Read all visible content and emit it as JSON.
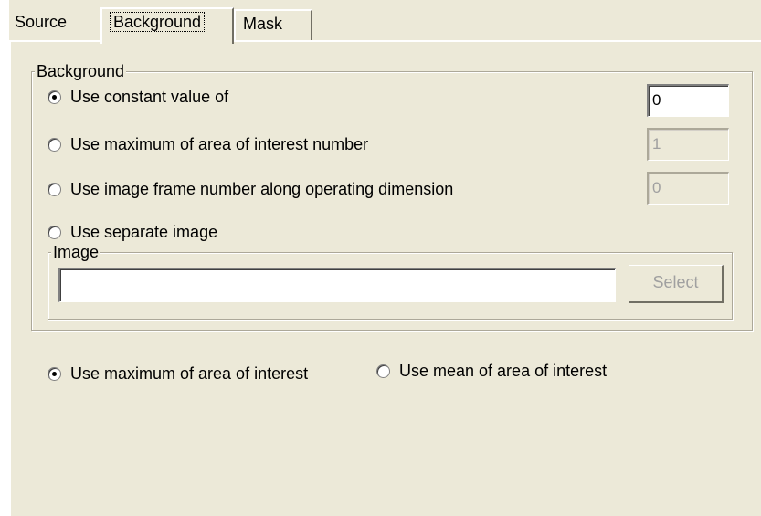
{
  "tabs": [
    {
      "label": "Source"
    },
    {
      "label": "Background"
    },
    {
      "label": "Mask"
    }
  ],
  "background_group": {
    "title": "Background",
    "options": [
      {
        "label": "Use constant value of",
        "checked": true,
        "value": "0",
        "value_enabled": true
      },
      {
        "label": "Use maximum of area of interest number",
        "checked": false,
        "value": "1",
        "value_enabled": false
      },
      {
        "label": "Use image frame number along operating dimension",
        "checked": false,
        "value": "0",
        "value_enabled": false
      },
      {
        "label": "Use separate image",
        "checked": false
      }
    ],
    "image_group": {
      "title": "Image",
      "path_value": "",
      "select_label": "Select"
    }
  },
  "roi_mode": [
    {
      "label": "Use maximum of area of interest",
      "checked": true
    },
    {
      "label": "Use mean of area of interest",
      "checked": false
    }
  ]
}
